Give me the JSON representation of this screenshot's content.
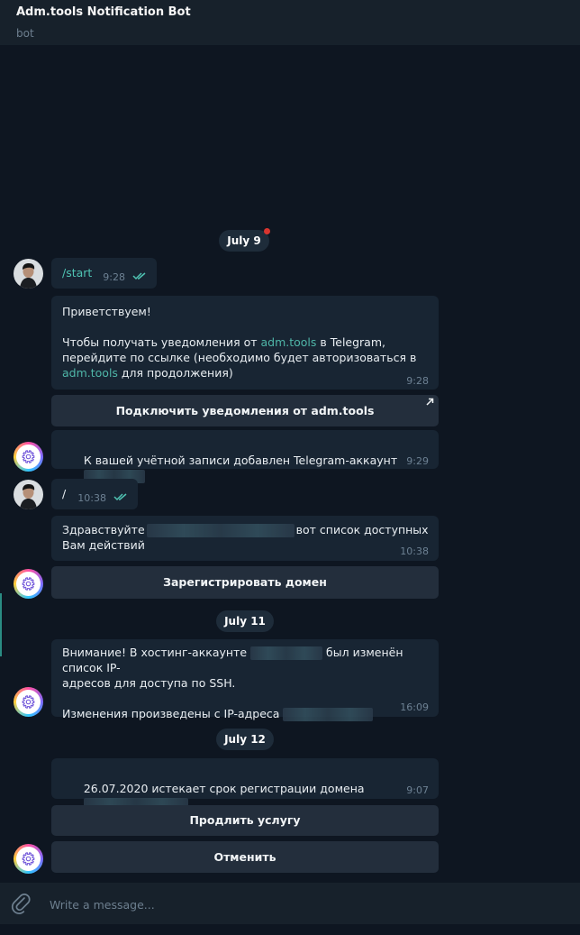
{
  "header": {
    "title": "Adm.tools Notification Bot",
    "status": "bot"
  },
  "dates": {
    "d1": "July 9",
    "d2": "July 11",
    "d3": "July 12"
  },
  "messages": {
    "m1": {
      "text": "/start",
      "time": "9:28"
    },
    "m2": {
      "line1": "Приветствуем!",
      "p2a": "Чтобы получать уведомления от ",
      "link1": "adm.tools",
      "p2b": " в Telegram,",
      "line3": "перейдите по ссылке (необходимо будет авторизоваться в",
      "link2": "adm.tools",
      "p4b": " для продолжения)",
      "time": "9:28"
    },
    "m3": {
      "text": "К вашей учётной записи добавлен Telegram-аккаунт",
      "time": "9:29"
    },
    "m4": {
      "text": "/",
      "time": "10:38"
    },
    "m5": {
      "a": "Здравствуйте",
      "b": "вот список доступных",
      "c": "Вам действий",
      "time": "10:38"
    },
    "m6": {
      "a": "Внимание! В хостинг-аккаунте",
      "b": "был изменён список IP-",
      "c": "адресов для доступа по SSH.",
      "d": "Изменения произведены с IP-адреса",
      "time": "16:09"
    },
    "m7": {
      "text": "26.07.2020 истекает срок регистрации домена",
      "time": "9:07"
    }
  },
  "buttons": {
    "connect": "Подключить уведомления от adm.tools",
    "register": "Зарегистрировать домен",
    "renew": "Продлить услугу",
    "cancel": "Отменить"
  },
  "composer": {
    "placeholder": "Write a message..."
  },
  "colors": {
    "background": "#0e1621",
    "bubble": "#182533",
    "button": "#232e3c",
    "link": "#4fb6a8",
    "read_ticks": "#4fc3b3"
  }
}
